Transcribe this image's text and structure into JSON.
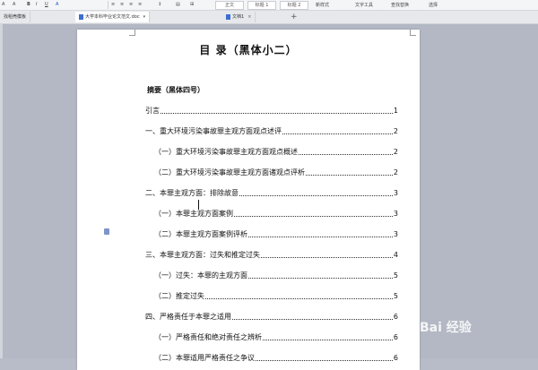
{
  "ribbon": {
    "tools": [
      "A",
      "A",
      "B",
      "I",
      "U",
      "A"
    ],
    "style_normal": "正文",
    "style_h1": "标题 1",
    "style_h2": "标题 2",
    "style_more": "新样式",
    "text_tools": "文字工具",
    "find_replace": "查找替换",
    "select": "选择"
  },
  "tabs": [
    {
      "label": "找稻壳模板",
      "active": false
    },
    {
      "label": "大学本科毕业论文范文.doc",
      "active": true
    },
    {
      "label": "文档1",
      "active": false
    }
  ],
  "document": {
    "title": "目  录（黑体小二）",
    "subtitle": "摘要（黑体四号）",
    "toc": [
      {
        "text": "引言",
        "page": "1"
      },
      {
        "text": "一、重大环境污染事故罪主观方面观点述评",
        "page": "2"
      },
      {
        "text": "（一）重大环境污染事故罪主观方面观点概述",
        "page": "2"
      },
      {
        "text": "（二）重大环境污染事故罪主观方面诸观点评析",
        "page": "2"
      },
      {
        "text": "二、本罪主观方面：排除故意",
        "page": "3"
      },
      {
        "text": "（一）本罪主观方面案例",
        "page": "3"
      },
      {
        "text": "（二）本罪主观方面案例评析",
        "page": "3"
      },
      {
        "text": "三、本罪主观方面：过失和推定过失",
        "page": "4"
      },
      {
        "text": "（一）过失：本罪的主观方面",
        "page": "5"
      },
      {
        "text": "（二）推定过失",
        "page": "5"
      },
      {
        "text": "四、严格责任于本罪之适用",
        "page": "6"
      },
      {
        "text": "（一）严格责任和绝对责任之辨析",
        "page": "6"
      },
      {
        "text": "（二）本罪适用严格责任之争议",
        "page": "6"
      }
    ]
  },
  "watermark": "Bai 经验"
}
